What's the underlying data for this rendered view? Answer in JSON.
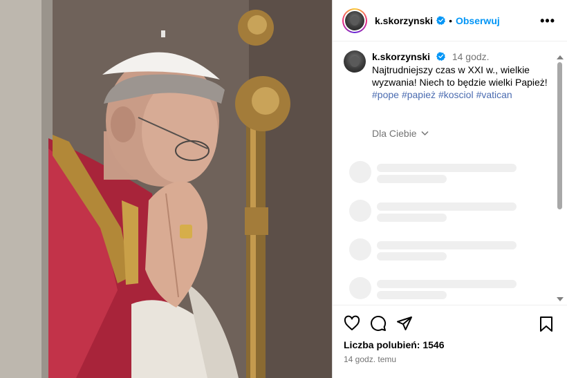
{
  "post": {
    "username": "k.skorzynski",
    "follow_label": "Obserwuj",
    "separator": "•",
    "more_label": "•••",
    "caption_username": "k.skorzynski",
    "caption_time": "14 godz.",
    "caption_text": "Najtrudniejszy czas w XXI w., wielkie wyzwania! Niech to będzie wielki Papież!",
    "hashtags": [
      "#pope",
      "#papież",
      "#kosciol",
      "#vatican"
    ],
    "for_you_label": "Dla Ciebie",
    "likes_label": "Liczba polubień: 1546",
    "time_ago": "14 godz. temu"
  },
  "icons": {
    "verified": "verified-badge-icon",
    "like": "heart-icon",
    "comment": "comment-icon",
    "share": "paper-plane-icon",
    "save": "bookmark-icon",
    "chevron": "chevron-down-icon"
  },
  "colors": {
    "link_blue": "#0095f6",
    "hashtag": "#4a6bb0",
    "muted": "#737373",
    "skeleton": "#efefef"
  }
}
